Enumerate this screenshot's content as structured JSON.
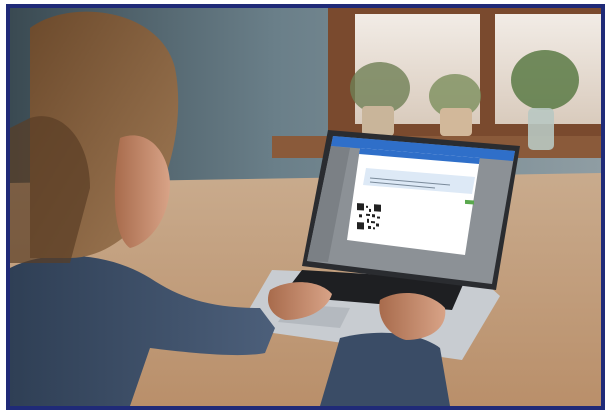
{
  "photo": {
    "subject": "person",
    "border_color": "#1f2a78"
  },
  "laptop_screen": {
    "accent": "#2f6fc9",
    "modal_accent": "#5aa84e"
  }
}
